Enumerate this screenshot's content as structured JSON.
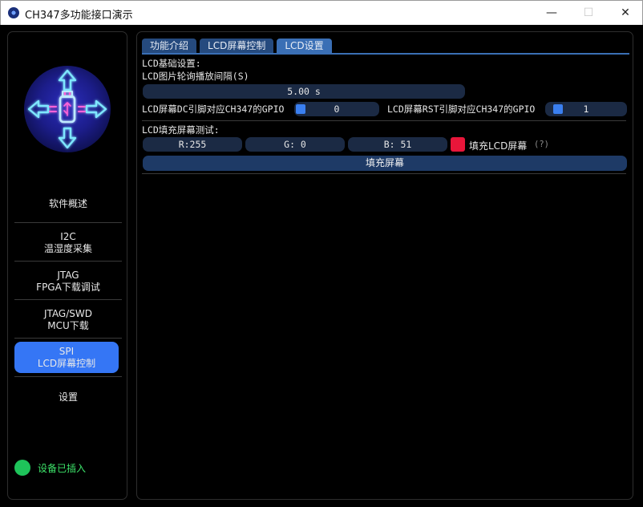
{
  "window": {
    "title": "CH347多功能接口演示",
    "minimize_glyph": "—",
    "maximize_glyph": "☐",
    "close_glyph": "✕"
  },
  "sidebar": {
    "logo_icon": "usb-arrows-logo-icon",
    "items": [
      {
        "line1": "软件概述",
        "line2": ""
      },
      {
        "line1": "I2C",
        "line2": "温湿度采集"
      },
      {
        "line1": "JTAG",
        "line2": "FPGA下载调试"
      },
      {
        "line1": "JTAG/SWD",
        "line2": "MCU下载"
      },
      {
        "line1": "SPI",
        "line2": "LCD屏幕控制",
        "active": true
      },
      {
        "line1": "设置",
        "line2": ""
      }
    ],
    "status": {
      "label": "设备已插入",
      "color": "#1ec35a"
    }
  },
  "main": {
    "tabs": [
      {
        "label": "功能介绍"
      },
      {
        "label": "LCD屏幕控制"
      },
      {
        "label": "LCD设置",
        "active": true
      }
    ],
    "basic_settings_label": "LCD基础设置:",
    "poll_interval_label": "LCD图片轮询播放间隔(S)",
    "poll_interval_value": "5.00 s",
    "dc_pin_label": "LCD屏幕DC引脚对应CH347的GPIO",
    "dc_pin_value": "0",
    "rst_pin_label": "LCD屏幕RST引脚对应CH347的GPIO",
    "rst_pin_value": "1",
    "fill_test_label": "LCD填充屏幕测试:",
    "r_value": "R:255",
    "g_value": "G:  0",
    "b_value": "B: 51",
    "fill_color": "#e8163a",
    "fill_color_label": "填充LCD屏幕",
    "help_marker": "(?)",
    "fill_button_label": "填充屏幕"
  },
  "colors": {
    "accent": "#3576f5",
    "tab_active": "#3a6fb5",
    "field_bg": "#1b2a44",
    "status_green": "#1ec35a"
  }
}
